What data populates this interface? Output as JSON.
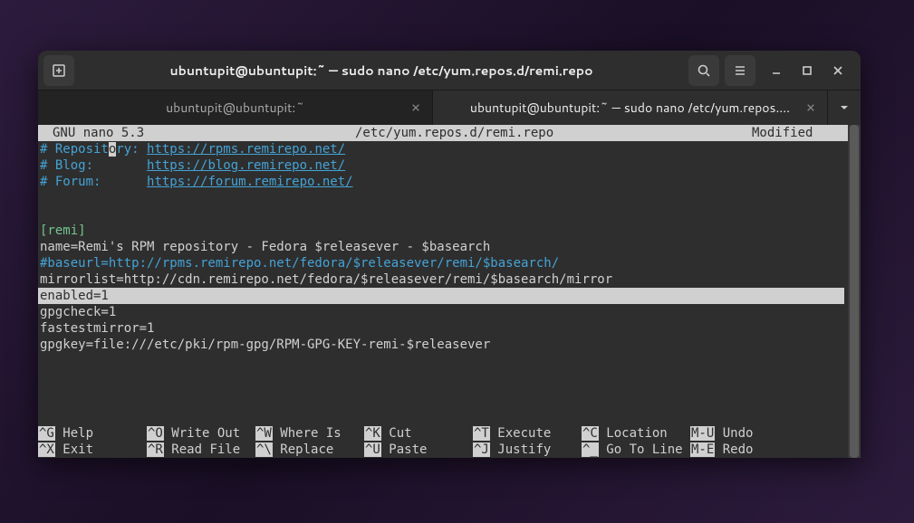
{
  "window": {
    "title": "ubuntupit@ubuntupit:~ — sudo nano /etc/yum.repos.d/remi.repo"
  },
  "tabs": [
    {
      "label": "ubuntupit@ubuntupit:~",
      "active": false
    },
    {
      "label": "ubuntupit@ubuntupit:~ — sudo nano /etc/yum.repos....",
      "active": true
    }
  ],
  "editor": {
    "status": {
      "left": "GNU nano 5.3",
      "mid": "/etc/yum.repos.d/remi.repo",
      "right": "Modified"
    },
    "lines": {
      "l1_pre": "# Reposit",
      "l1_cur": "o",
      "l1_post": "ry: ",
      "l1_url": "https://rpms.remirepo.net/",
      "l2_pre": "# Blog:       ",
      "l2_url": "https://blog.remirepo.net/",
      "l3_pre": "# Forum:      ",
      "l3_url": "https://forum.remirepo.net/",
      "l4": "[remi]",
      "l5": "name=Remi's RPM repository - Fedora $releasever - $basearch",
      "l6": "#baseurl=http://rpms.remirepo.net/fedora/$releasever/remi/$basearch/",
      "l7": "mirrorlist=http://cdn.remirepo.net/fedora/$releasever/remi/$basearch/mirror",
      "l8": "enabled=1",
      "l9": "gpgcheck=1",
      "l10": "fastestmirror=1",
      "l11": "gpgkey=file:///etc/pki/rpm-gpg/RPM-GPG-KEY-remi-$releasever"
    },
    "shortcuts": {
      "row1": [
        {
          "key": "^G",
          "label": "Help"
        },
        {
          "key": "^O",
          "label": "Write Out"
        },
        {
          "key": "^W",
          "label": "Where Is"
        },
        {
          "key": "^K",
          "label": "Cut"
        },
        {
          "key": "^T",
          "label": "Execute"
        },
        {
          "key": "^C",
          "label": "Location"
        },
        {
          "key": "M-U",
          "label": "Undo"
        }
      ],
      "row2": [
        {
          "key": "^X",
          "label": "Exit"
        },
        {
          "key": "^R",
          "label": "Read File"
        },
        {
          "key": "^\\",
          "label": "Replace"
        },
        {
          "key": "^U",
          "label": "Paste"
        },
        {
          "key": "^J",
          "label": "Justify"
        },
        {
          "key": "^_",
          "label": "Go To Line"
        },
        {
          "key": "M-E",
          "label": "Redo"
        }
      ]
    }
  }
}
